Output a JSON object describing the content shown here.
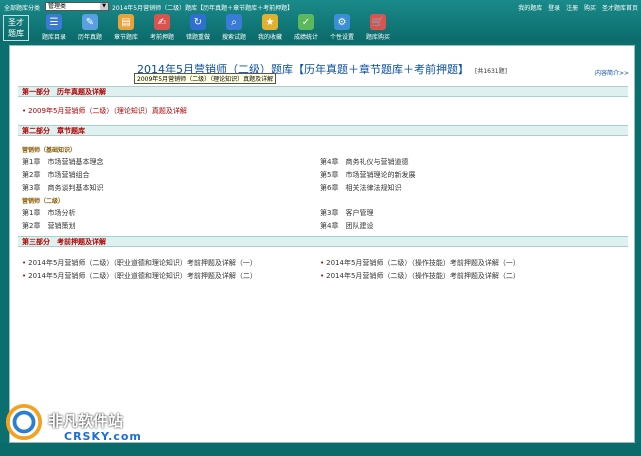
{
  "topbar": {
    "category_label": "全部题库分类",
    "category_value": "管理类",
    "window_title": "2014年5月营销师（二级）题库【历年真题＋章节题库＋考前押题】",
    "links": [
      "我的题库",
      "登录",
      "注册",
      "购买",
      "圣才题库首页"
    ],
    "logo_text": "圣才题库"
  },
  "toolbar": {
    "items": [
      {
        "label": "题库目录",
        "icon": "catalog-icon",
        "color": "#3a7bd5"
      },
      {
        "label": "历年真题",
        "icon": "exam-paper-icon",
        "color": "#5aa0e0"
      },
      {
        "label": "章节题库",
        "icon": "chapter-icon",
        "color": "#e8a23a"
      },
      {
        "label": "考前押题",
        "icon": "forecast-icon",
        "color": "#d9534f"
      },
      {
        "label": "错题重做",
        "icon": "redo-icon",
        "color": "#2f6fd1"
      },
      {
        "label": "搜索试题",
        "icon": "search-icon",
        "color": "#3a7bd5"
      },
      {
        "label": "我的收藏",
        "icon": "favorite-icon",
        "color": "#e0b030"
      },
      {
        "label": "成绩统计",
        "icon": "statistics-icon",
        "color": "#5cb85c"
      },
      {
        "label": "个性设置",
        "icon": "settings-icon",
        "color": "#3a8fd5"
      },
      {
        "label": "题库购买",
        "icon": "cart-icon",
        "color": "#d9534f"
      }
    ]
  },
  "main": {
    "title": "2014年5月营销师（二级）题库【历年真题＋章节题库＋考前押题】",
    "count": "[共1631题]",
    "intro_link": "内容简介>>",
    "tooltip": "2009年5月营销师（二级）（理论知识）真题及详解",
    "part1": {
      "header": "第一部分　历年真题及详解",
      "items": [
        "2009年5月营销师（二级）（理论知识）真题及详解"
      ]
    },
    "part2": {
      "header": "第二部分　章节题库",
      "group1": {
        "title": "营销师（基础知识）",
        "left": [
          "第1章　市场营销基本理念",
          "第2章　市场营销组合",
          "第3章　商务谈判基本知识"
        ],
        "right": [
          "第4章　商务礼仪与营销道德",
          "第5章　市场营销理论的新发展",
          "第6章　相关法律法规知识"
        ]
      },
      "group2": {
        "title": "营销师（二级）",
        "left": [
          "第1章　市场分析",
          "第2章　营销策划"
        ],
        "right": [
          "第3章　客户管理",
          "第4章　团队建设"
        ]
      }
    },
    "part3": {
      "header": "第三部分　考前押题及详解",
      "left": [
        "2014年5月营销师（二级）（职业道德和理论知识）考前押题及详解（一）",
        "2014年5月营销师（二级）（职业道德和理论知识）考前押题及详解（二）"
      ],
      "right": [
        "2014年5月营销师（二级）（操作技能）考前押题及详解（一）",
        "2014年5月营销师（二级）（操作技能）考前押题及详解（二）"
      ]
    }
  },
  "watermark": {
    "text": "非凡软件站",
    "sub": "CRSKY.com"
  }
}
